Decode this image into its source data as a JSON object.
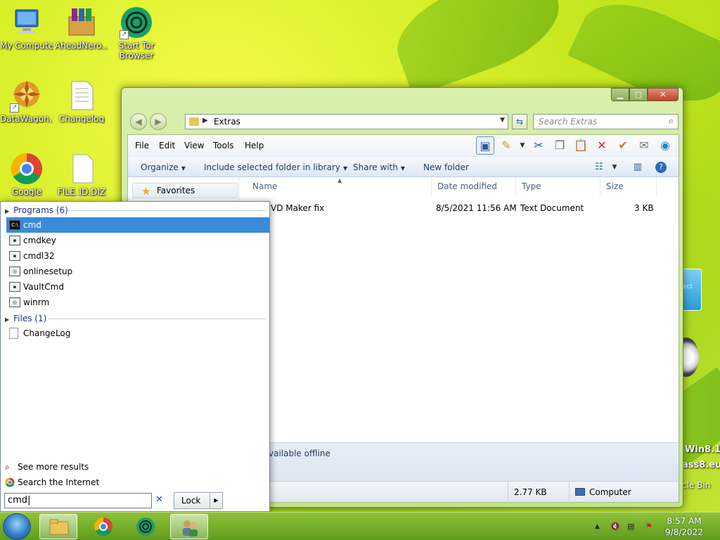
{
  "desktop": {
    "icons": [
      {
        "label": "My Computer"
      },
      {
        "label": "AheadNero..."
      },
      {
        "label": "Start Tor Browser"
      },
      {
        "label": "DataWagon..."
      },
      {
        "label": "Changelog"
      },
      {
        "label": "Google"
      },
      {
        "label": "FILE_ID.DIZ"
      }
    ],
    "right_text": {
      "line1": "Win8.1",
      "line2": "ass8.eu",
      "line3": "cle Bin",
      "gadget": "ect"
    }
  },
  "explorer": {
    "address": {
      "path": "Extras"
    },
    "search": {
      "placeholder": "Search Extras"
    },
    "menu": {
      "file": "File",
      "edit": "Edit",
      "view": "View",
      "tools": "Tools",
      "help": "Help"
    },
    "commands": {
      "organize": "Organize",
      "include": "Include selected folder in library",
      "share": "Share with",
      "new_folder": "New folder"
    },
    "nav": {
      "favorites": "Favorites"
    },
    "columns": {
      "name": "Name",
      "date": "Date modified",
      "type": "Type",
      "size": "Size"
    },
    "files": [
      {
        "name": "VD Maker fix",
        "date": "8/5/2021 11:56 AM",
        "type": "Text Document",
        "size": "3 KB"
      }
    ],
    "details": {
      "offline": "vailable offline"
    },
    "status": {
      "size": "2.77 KB",
      "location": "Computer"
    }
  },
  "startmenu": {
    "programs_header": "Programs (6)",
    "programs": [
      {
        "label": "cmd",
        "icon": "cmd-icon"
      },
      {
        "label": "cmdkey",
        "icon": "app-icon"
      },
      {
        "label": "cmdl32",
        "icon": "app-icon"
      },
      {
        "label": "onlinesetup",
        "icon": "app-icon"
      },
      {
        "label": "VaultCmd",
        "icon": "app-icon"
      },
      {
        "label": "winrm",
        "icon": "app-icon"
      }
    ],
    "files_header": "Files (1)",
    "files": [
      {
        "label": "ChangeLog"
      }
    ],
    "see_more": "See more results",
    "search_internet": "Search the Internet",
    "search_value": "cmd",
    "lock_label": "Lock"
  },
  "taskbar": {
    "time": "8:57 AM",
    "date": "9/8/2022"
  }
}
